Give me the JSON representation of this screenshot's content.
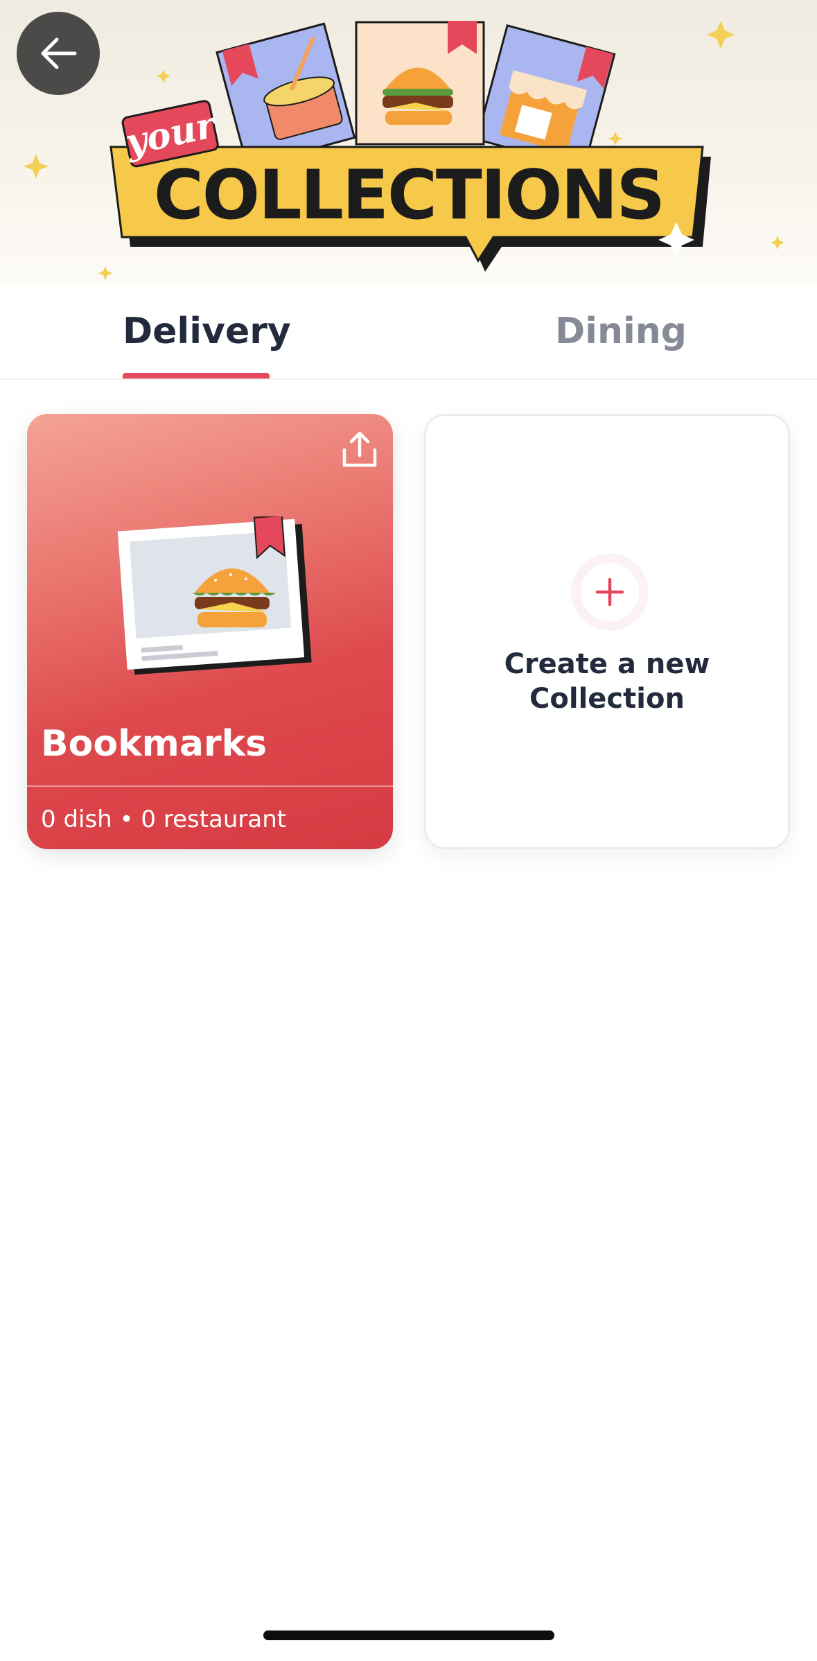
{
  "header": {
    "banner_title_script": "your",
    "banner_title": "COLLECTIONS",
    "back_icon": "arrow-left-icon"
  },
  "tabs": [
    {
      "label": "Delivery",
      "active": true
    },
    {
      "label": "Dining",
      "active": false
    }
  ],
  "collections": {
    "bookmarks": {
      "title": "Bookmarks",
      "subtitle": "0 dish • 0 restaurant",
      "share_icon": "share-upload-icon"
    },
    "create_new": {
      "label_line1": "Create a new",
      "label_line2": "Collection",
      "icon": "plus-icon"
    }
  },
  "colors": {
    "accent": "#e5485a",
    "text_primary": "#242a3d",
    "text_inactive": "#868a96",
    "bookmark_card": "#d63a42",
    "banner_yellow": "#f7c94a"
  }
}
